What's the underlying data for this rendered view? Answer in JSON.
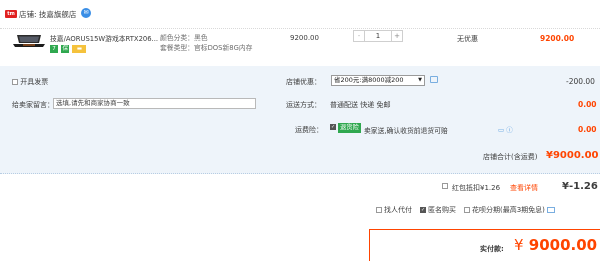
{
  "store": {
    "icon_text": "tm",
    "label": "店铺: 技嘉旗舰店",
    "chat_icon": "wangwang-chat-icon"
  },
  "item": {
    "title": "技嘉/AORUS15W游戏本RTX206...",
    "badges": [
      "7",
      "保"
    ],
    "attr_color": "颜色分类：黑色",
    "attr_package": "套餐类型：官标DOS新8G内存",
    "price": "9200.00",
    "quantity": {
      "minus": "-",
      "value": "1",
      "plus": "+"
    },
    "promotion": "无优惠",
    "subtotal": "9200.00"
  },
  "panel": {
    "invoice": "开具发票",
    "shop_promo_label": "店铺优惠：",
    "shop_promo_value": "省200元:满8000减200",
    "discount": "-200.00",
    "message_label": "给卖家留言：",
    "message_value": "选填,请先和商家协商一致",
    "shipping_label": "运送方式：",
    "shipping_value": "普通配送 快递 免邮",
    "shipping_price": "0.00",
    "insurance_label": "运费险：",
    "insurance_tag": "退货险",
    "insurance_text": "卖家送,确认收货前退货可赔",
    "insurance_price": "0.00",
    "store_total_label": "店铺合计(含运费)",
    "store_total": "¥9000.00"
  },
  "redpacket": {
    "label": "红包抵扣¥1.26",
    "link": "查看详情",
    "amount": "¥-1.26"
  },
  "options": {
    "proxy_pay": "找人代付",
    "anonymous": "匿名购买",
    "huabei": "花呗分期(最高3期免息)"
  },
  "total": {
    "label": "实付款:",
    "yen": "¥",
    "value": "9000.00"
  },
  "colors": {
    "accent": "#ff4400",
    "panel_bg": "#eef4fa",
    "green_tag": "#2fa84f"
  }
}
